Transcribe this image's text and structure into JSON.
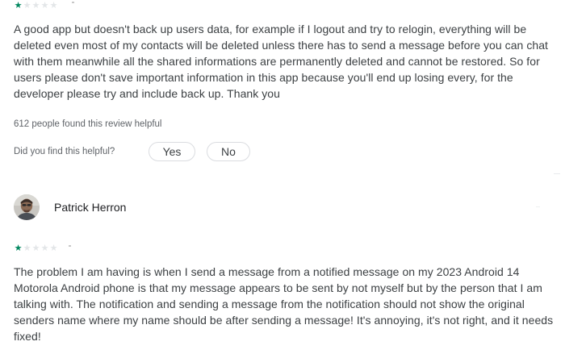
{
  "reviews": [
    {
      "rating": 1,
      "max_rating": 5,
      "text": "A good app but doesn't back up users data, for example if I logout and try to relogin, everything will be deleted even most of my contacts will be deleted unless there has to send a message before you can chat with them meanwhile all the shared informations are permanently deleted and cannot be restored. So for users please don't save important information in this app because you'll end up losing every, for the developer please try and include back up. Thank you",
      "helpful_count_text": "612 people found this review helpful",
      "helpful_question": "Did you find this helpful?",
      "yes_label": "Yes",
      "no_label": "No"
    },
    {
      "author": "Patrick Herron",
      "rating": 1,
      "max_rating": 5,
      "text": "The problem I am having is when I send a message from a notified message on my 2023 Android 14 Motorola Android phone is that my message appears to be sent by not myself but by the person that I am talking with. The notification and sending a message from the notification should not show the original senders name where my name should be after sending a message! It's annoying, it's not right, and it needs fixed!"
    }
  ],
  "colors": {
    "star_filled": "#01875f",
    "star_empty": "#e3e6e8",
    "text": "#3c4043",
    "secondary_text": "#5f6368"
  }
}
